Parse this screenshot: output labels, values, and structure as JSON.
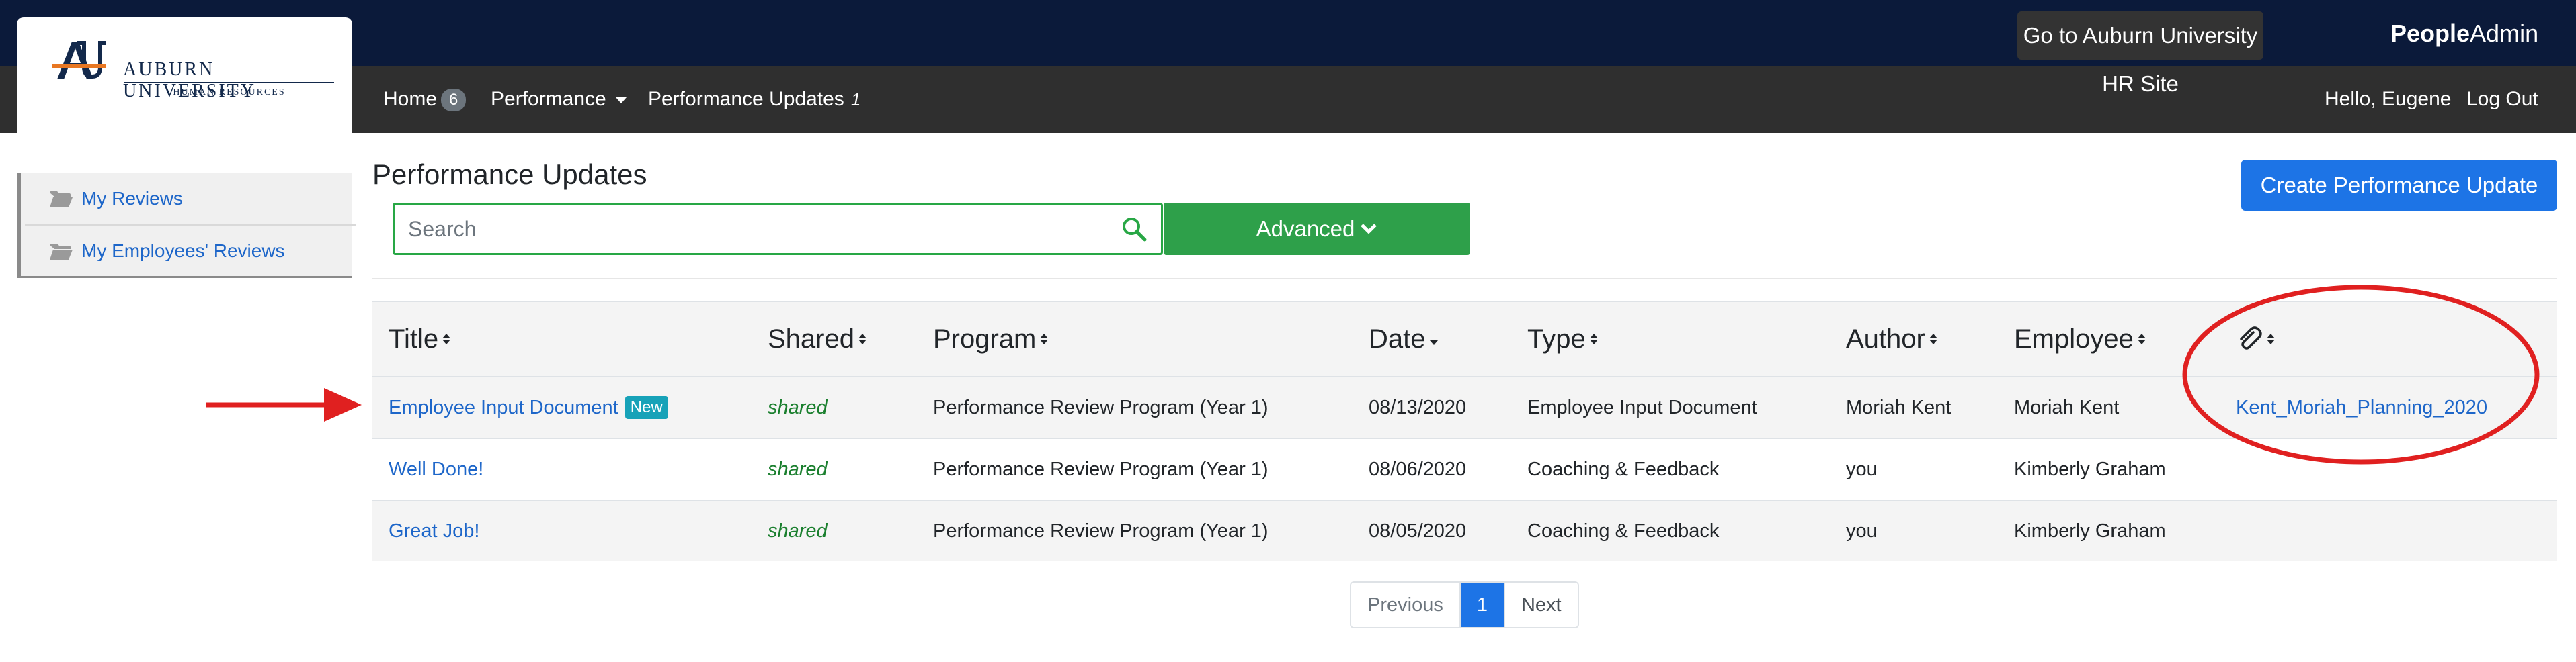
{
  "header": {
    "hr_site_button": "Go to Auburn University HR Site",
    "brand_bold": "People",
    "brand_light": "Admin",
    "logo": {
      "line1": "AUBURN UNIVERSITY",
      "line2": "HUMAN RESOURCES"
    }
  },
  "nav": {
    "home_label": "Home",
    "home_count": "6",
    "performance_label": "Performance",
    "updates_label": "Performance Updates",
    "updates_count": "1",
    "greeting": "Hello, Eugene",
    "logout": "Log Out"
  },
  "sidebar": {
    "items": [
      {
        "label": "My Reviews",
        "icon": "folder-open-icon"
      },
      {
        "label": "My Employees' Reviews",
        "icon": "folder-open-icon"
      }
    ]
  },
  "page": {
    "title": "Performance Updates",
    "create_button": "Create Performance Update",
    "search_placeholder": "Search",
    "advanced_button": "Advanced"
  },
  "table": {
    "headers": {
      "title": "Title",
      "shared": "Shared",
      "program": "Program",
      "date": "Date",
      "type": "Type",
      "author": "Author",
      "employee": "Employee",
      "attachment_icon": "paperclip-icon"
    },
    "rows": [
      {
        "title": "Employee Input Document",
        "badge": "New",
        "shared": "shared",
        "program": "Performance Review Program (Year 1)",
        "date": "08/13/2020",
        "type": "Employee Input Document",
        "author": "Moriah Kent",
        "employee": "Moriah Kent",
        "attachment": "Kent_Moriah_Planning_2020"
      },
      {
        "title": "Well Done!",
        "shared": "shared",
        "program": "Performance Review Program (Year 1)",
        "date": "08/06/2020",
        "type": "Coaching & Feedback",
        "author": "you",
        "employee": "Kimberly Graham"
      },
      {
        "title": "Great Job!",
        "shared": "shared",
        "program": "Performance Review Program (Year 1)",
        "date": "08/05/2020",
        "type": "Coaching & Feedback",
        "author": "you",
        "employee": "Kimberly Graham"
      }
    ]
  },
  "pagination": {
    "previous": "Previous",
    "current": "1",
    "next": "Next"
  },
  "colors": {
    "header_bg": "#0b1a3a",
    "nav_bg": "#2f2f2f",
    "primary": "#1d74e6",
    "success": "#2ea04a",
    "link": "#1d66c9",
    "annotation": "#e02020"
  }
}
